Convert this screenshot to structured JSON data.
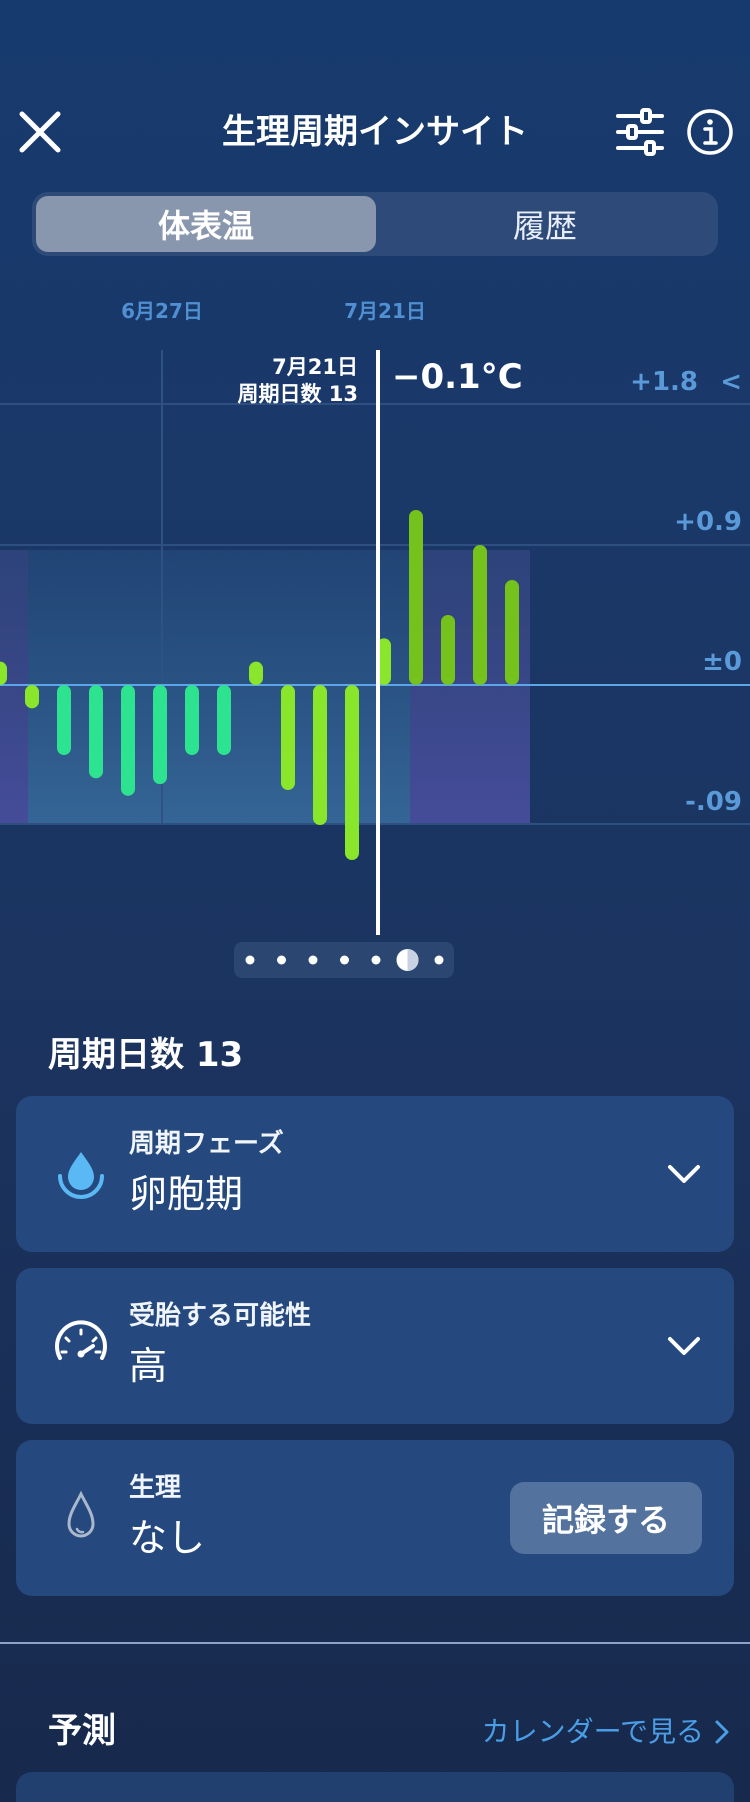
{
  "header": {
    "title": "生理周期インサイト"
  },
  "tabs": [
    {
      "label": "体表温",
      "selected": true
    },
    {
      "label": "履歴",
      "selected": false
    }
  ],
  "chart_data": {
    "type": "bar",
    "date_labels": [
      "6月27日",
      "7月21日"
    ],
    "y_tick_labels": [
      "+1.8",
      "+0.9",
      "±0",
      "-.09"
    ],
    "ylim": [
      -0.12,
      0.12
    ],
    "values": [
      0.02,
      -0.02,
      -0.06,
      -0.08,
      -0.095,
      -0.085,
      -0.06,
      -0.06,
      0.02,
      -0.09,
      -0.12,
      -0.15,
      0.04,
      0.15,
      0.06,
      0.12,
      0.09
    ],
    "selected_index": 12,
    "tooltip": {
      "date": "7月21日",
      "cycle_day": "周期日数 13",
      "value": "−0.1°C"
    },
    "scroll_arrow": "<",
    "colors": {
      "follicular_bar": "#2ee38f",
      "ovulation_bar": "#8ae62a",
      "luteal_bar": "#76c21c",
      "baseline": "#5aa6e8",
      "highlight_line": "#ffffff"
    },
    "grid": true
  },
  "pagination": {
    "count": 7,
    "active": 5
  },
  "cycle_day_heading": "周期日数 13",
  "cards": {
    "phase": {
      "label": "周期フェーズ",
      "value": "卵胞期",
      "icon": "droplet-icon"
    },
    "fertility": {
      "label": "受胎する可能性",
      "value": "高",
      "icon": "gauge-icon"
    },
    "period": {
      "label": "生理",
      "value": "なし",
      "icon": "drop-outline-icon",
      "button": "記録する"
    }
  },
  "predictions": {
    "heading": "予測",
    "calendar_link": "カレンダーで見る"
  },
  "colors": {
    "background": "#1b3766",
    "card": "#25497e",
    "accent_blue": "#4a9ee6",
    "icon_blue": "#5ab8f5"
  }
}
